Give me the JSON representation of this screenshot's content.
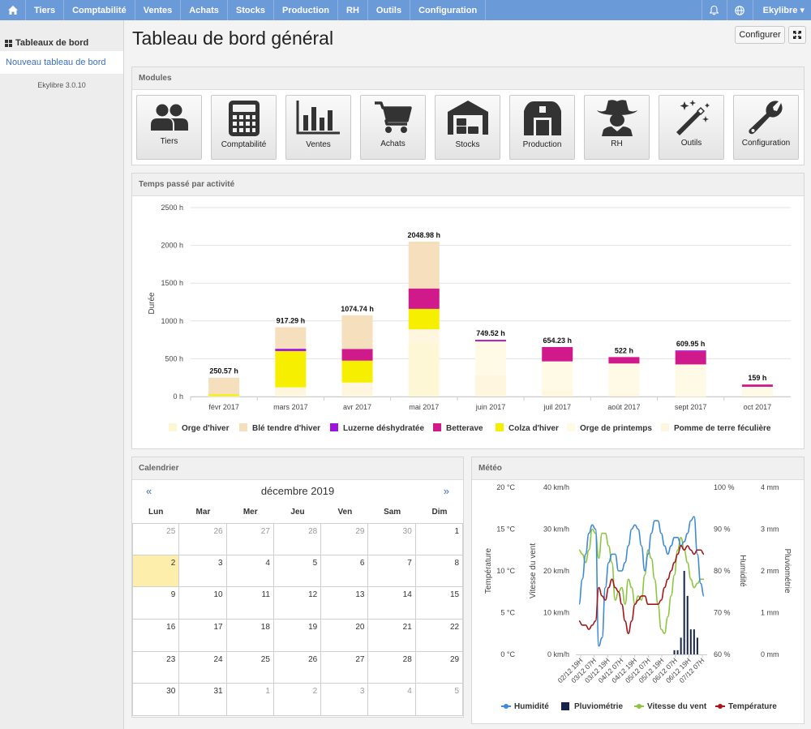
{
  "nav": {
    "items": [
      "Tiers",
      "Comptabilité",
      "Ventes",
      "Achats",
      "Stocks",
      "Production",
      "RH",
      "Outils",
      "Configuration"
    ],
    "user": "Ekylibre ▾"
  },
  "sidebar": {
    "title": "Tableaux de bord",
    "link": "Nouveau tableau de bord",
    "version": "Ekylibre 3.0.10"
  },
  "page": {
    "title": "Tableau de bord général",
    "configure_label": "Configurer"
  },
  "modules": {
    "title": "Modules",
    "items": [
      {
        "label": "Tiers",
        "icon": "users-icon"
      },
      {
        "label": "Comptabilité",
        "icon": "calculator-icon"
      },
      {
        "label": "Ventes",
        "icon": "bar-chart-icon"
      },
      {
        "label": "Achats",
        "icon": "shopping-cart-icon"
      },
      {
        "label": "Stocks",
        "icon": "warehouse-icon"
      },
      {
        "label": "Production",
        "icon": "barn-icon"
      },
      {
        "label": "RH",
        "icon": "cowboy-icon"
      },
      {
        "label": "Outils",
        "icon": "magic-wand-icon"
      },
      {
        "label": "Configuration",
        "icon": "wrench-icon"
      }
    ]
  },
  "time_panel": {
    "title": "Temps passé par activité"
  },
  "calendar": {
    "title": "Calendrier",
    "month": "décembre 2019",
    "prev": "«",
    "next": "»",
    "dows": [
      "Lun",
      "Mar",
      "Mer",
      "Jeu",
      "Ven",
      "Sam",
      "Dim"
    ],
    "days": [
      {
        "d": "25",
        "other": true
      },
      {
        "d": "26",
        "other": true
      },
      {
        "d": "27",
        "other": true
      },
      {
        "d": "28",
        "other": true
      },
      {
        "d": "29",
        "other": true
      },
      {
        "d": "30",
        "other": true
      },
      {
        "d": "1",
        "other": false
      },
      {
        "d": "2",
        "other": false,
        "today": true
      },
      {
        "d": "3",
        "other": false
      },
      {
        "d": "4",
        "other": false
      },
      {
        "d": "5",
        "other": false
      },
      {
        "d": "6",
        "other": false
      },
      {
        "d": "7",
        "other": false
      },
      {
        "d": "8",
        "other": false
      },
      {
        "d": "9",
        "other": false
      },
      {
        "d": "10",
        "other": false
      },
      {
        "d": "11",
        "other": false
      },
      {
        "d": "12",
        "other": false
      },
      {
        "d": "13",
        "other": false
      },
      {
        "d": "14",
        "other": false
      },
      {
        "d": "15",
        "other": false
      },
      {
        "d": "16",
        "other": false
      },
      {
        "d": "17",
        "other": false
      },
      {
        "d": "18",
        "other": false
      },
      {
        "d": "19",
        "other": false
      },
      {
        "d": "20",
        "other": false
      },
      {
        "d": "21",
        "other": false
      },
      {
        "d": "22",
        "other": false
      },
      {
        "d": "23",
        "other": false
      },
      {
        "d": "24",
        "other": false
      },
      {
        "d": "25",
        "other": false
      },
      {
        "d": "26",
        "other": false
      },
      {
        "d": "27",
        "other": false
      },
      {
        "d": "28",
        "other": false
      },
      {
        "d": "29",
        "other": false
      },
      {
        "d": "30",
        "other": false
      },
      {
        "d": "31",
        "other": false
      },
      {
        "d": "1",
        "other": true
      },
      {
        "d": "2",
        "other": true
      },
      {
        "d": "3",
        "other": true
      },
      {
        "d": "4",
        "other": true
      },
      {
        "d": "5",
        "other": true
      }
    ]
  },
  "meteo_panel": {
    "title": "Météo"
  },
  "chart_data": [
    {
      "type": "bar",
      "stacked": true,
      "ylabel": "Durée",
      "ylim": [
        0,
        2500
      ],
      "yticks": [
        "0 h",
        "500 h",
        "1000 h",
        "1500 h",
        "2000 h",
        "2500 h"
      ],
      "categories": [
        "févr 2017",
        "mars 2017",
        "avr 2017",
        "mai 2017",
        "juin 2017",
        "juil 2017",
        "août 2017",
        "sept 2017",
        "oct 2017"
      ],
      "totals": [
        "250.57 h",
        "917.29 h",
        "1074.74 h",
        "2048.98 h",
        "749.52 h",
        "654.23 h",
        "522 h",
        "609.95 h",
        "159 h"
      ],
      "series": [
        {
          "name": "Orge d'hiver",
          "color": "#fdf7d5",
          "values": [
            5,
            0,
            0,
            720,
            0,
            0,
            0,
            0,
            0
          ]
        },
        {
          "name": "Blé tendre d'hiver",
          "color": "#f5dfbc",
          "values": [
            220,
            285,
            445,
            620,
            0,
            0,
            0,
            0,
            0
          ]
        },
        {
          "name": "Luzerne déshydratée",
          "color": "#9b14e0",
          "values": [
            0,
            30,
            0,
            0,
            10,
            0,
            0,
            10,
            0
          ]
        },
        {
          "name": "Betterave",
          "color": "#d01a8c",
          "values": [
            0,
            0,
            155,
            270,
            10,
            190,
            85,
            175,
            30
          ]
        },
        {
          "name": "Colza d'hiver",
          "color": "#f6f000",
          "values": [
            25,
            480,
            290,
            270,
            0,
            0,
            0,
            0,
            0
          ]
        },
        {
          "name": "Orge de printemps",
          "color": "#fefae6",
          "values": [
            0,
            0,
            0,
            0,
            450,
            380,
            400,
            420,
            110
          ]
        },
        {
          "name": "Pomme de terre féculière",
          "color": "#fef6df",
          "values": [
            0,
            122,
            185,
            170,
            280,
            85,
            37,
            5,
            19
          ]
        }
      ]
    },
    {
      "type": "line",
      "x": [
        "02/12 19H",
        "03/12 07H",
        "03/12 19H",
        "04/12 07H",
        "04/12 19H",
        "05/12 07H",
        "05/12 19H",
        "06/12 07H",
        "06/12 19H",
        "07/12 07H"
      ],
      "axes": {
        "temperature": {
          "label": "Température",
          "ticks": [
            "0 °C",
            "5 °C",
            "10 °C",
            "15 °C",
            "20 °C"
          ]
        },
        "wind": {
          "label": "Vitesse du vent",
          "ticks": [
            "0 km/h",
            "10 km/h",
            "20 km/h",
            "30 km/h",
            "40 km/h"
          ]
        },
        "humidity": {
          "label": "Humidité",
          "ticks": [
            "60 %",
            "70 %",
            "80 %",
            "90 %",
            "100 %"
          ]
        },
        "rain": {
          "label": "Pluviométrie",
          "ticks": [
            "0 mm",
            "1 mm",
            "2 mm",
            "3 mm",
            "4 mm"
          ]
        }
      },
      "series": [
        {
          "name": "Humidité",
          "color": "#3e8ad6",
          "axis": "humidity",
          "values": [
            72,
            78,
            84,
            89,
            91,
            90,
            62,
            64,
            76,
            82,
            84,
            84,
            80,
            80,
            82,
            86,
            90,
            91,
            90,
            86,
            80,
            84,
            89,
            92,
            92,
            89,
            86,
            84,
            86,
            88,
            88,
            86,
            87,
            89,
            92,
            93,
            84,
            77,
            74
          ]
        },
        {
          "name": "Pluviométrie",
          "color": "#16244a",
          "axis": "rain",
          "values": [
            0,
            0,
            0,
            0,
            0,
            0,
            0,
            0,
            0,
            0,
            0,
            0,
            0,
            0,
            0,
            0,
            0,
            0,
            0,
            0,
            0,
            0,
            0,
            0,
            0,
            0,
            0,
            0,
            0,
            0.1,
            0.1,
            0.4,
            2.0,
            1.4,
            0.6,
            0.6,
            0.4,
            0,
            0
          ]
        },
        {
          "name": "Vitesse du vent",
          "color": "#8cc63f",
          "axis": "wind",
          "values": [
            25,
            24,
            22,
            25,
            30,
            29,
            23,
            29,
            29,
            26,
            22,
            13,
            15,
            16,
            12,
            18,
            16,
            12,
            14,
            13,
            19,
            25,
            23,
            18,
            12,
            6,
            5,
            9,
            14,
            19,
            25,
            28,
            25,
            22,
            18,
            16,
            17,
            18,
            18
          ]
        },
        {
          "name": "Température",
          "color": "#a3171a",
          "axis": "temperature",
          "values": [
            4,
            3.5,
            3.5,
            3,
            3.5,
            4,
            8,
            7,
            6.5,
            8,
            9,
            8,
            7.5,
            6,
            4,
            2.5,
            4,
            6,
            6.5,
            7,
            7,
            6,
            6,
            6,
            6,
            6.5,
            8,
            9,
            10,
            11,
            12,
            13,
            12.5,
            13,
            12.5,
            12,
            12.5,
            12.5,
            12
          ]
        }
      ]
    }
  ]
}
